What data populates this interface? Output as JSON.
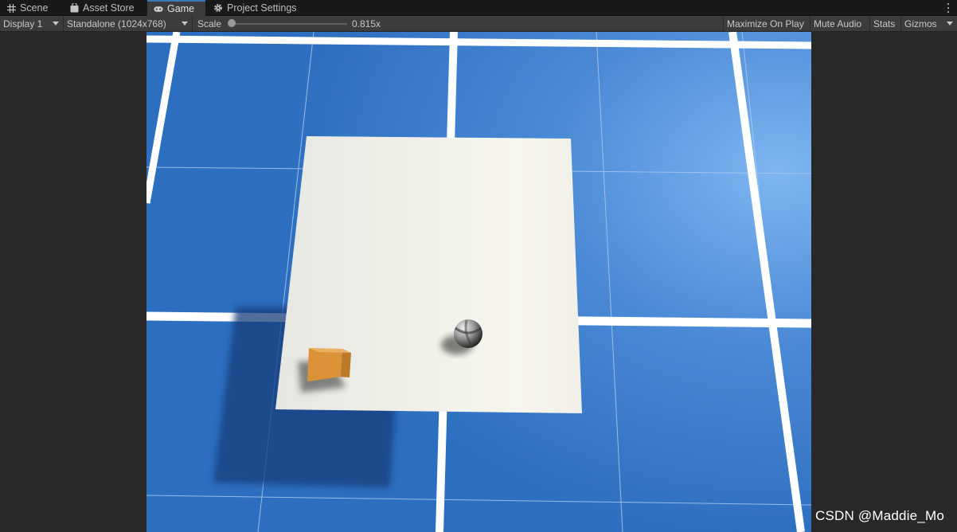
{
  "tabs": [
    {
      "label": "Scene",
      "icon": "grid-icon",
      "active": false
    },
    {
      "label": "Asset Store",
      "icon": "bag-icon",
      "active": false
    },
    {
      "label": "Game",
      "icon": "gamepad-icon",
      "active": true
    },
    {
      "label": "Project Settings",
      "icon": "gear-icon",
      "active": false
    }
  ],
  "toolbar": {
    "display": "Display 1",
    "resolution": "Standalone (1024x768)",
    "scale_label": "Scale",
    "scale_value": "0.815x",
    "maximize": "Maximize On Play",
    "mute": "Mute Audio",
    "stats": "Stats",
    "gizmos": "Gizmos"
  },
  "watermark": "CSDN @Maddie_Mo",
  "colors": {
    "tab_accent": "#3a79bb",
    "ground": "#2c6ebf",
    "plane": "#f2f1ea",
    "cube": "#dc9338",
    "editor_bg": "#282828"
  }
}
